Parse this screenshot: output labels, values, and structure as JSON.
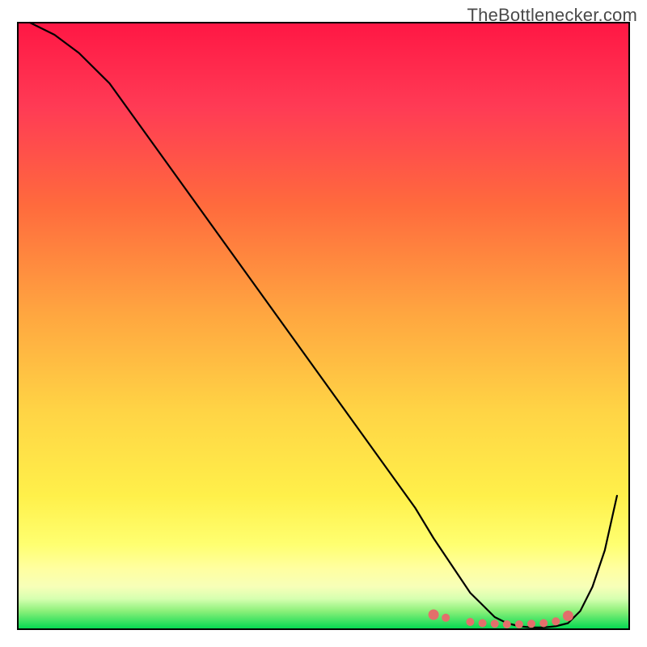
{
  "watermark": "TheBottlenecker.com",
  "colors": {
    "frame": "#000000",
    "curve": "#000000",
    "marker": "#e36f6b",
    "gradient_top": "#ff1744",
    "gradient_mid_upper": "#ff6a3d",
    "gradient_mid": "#ffb640",
    "gradient_mid_lower": "#ffe748",
    "gradient_band": "#ffff8a",
    "gradient_bottom": "#00d850"
  },
  "chart_data": {
    "type": "line",
    "title": "",
    "xlabel": "",
    "ylabel": "",
    "xlim": [
      0,
      100
    ],
    "ylim": [
      0,
      100
    ],
    "grid": false,
    "legend": false,
    "series": [
      {
        "name": "bottleneck-curve",
        "x": [
          2,
          6,
          10,
          15,
          20,
          25,
          30,
          35,
          40,
          45,
          50,
          55,
          60,
          65,
          68,
          70,
          72,
          74,
          76,
          78,
          80,
          82,
          84,
          86,
          88,
          90,
          92,
          94,
          96,
          98
        ],
        "y": [
          100,
          98,
          95,
          90,
          83,
          76,
          69,
          62,
          55,
          48,
          41,
          34,
          27,
          20,
          15,
          12,
          9,
          6,
          4,
          2,
          1,
          0.5,
          0.3,
          0.3,
          0.5,
          1,
          3,
          7,
          13,
          22
        ]
      }
    ],
    "markers": {
      "name": "optimal-range",
      "x": [
        68,
        70,
        74,
        76,
        78,
        80,
        82,
        84,
        86,
        88,
        90
      ],
      "y": [
        2.4,
        1.9,
        1.2,
        1.0,
        0.9,
        0.8,
        0.8,
        0.9,
        1.0,
        1.3,
        2.2
      ]
    }
  }
}
